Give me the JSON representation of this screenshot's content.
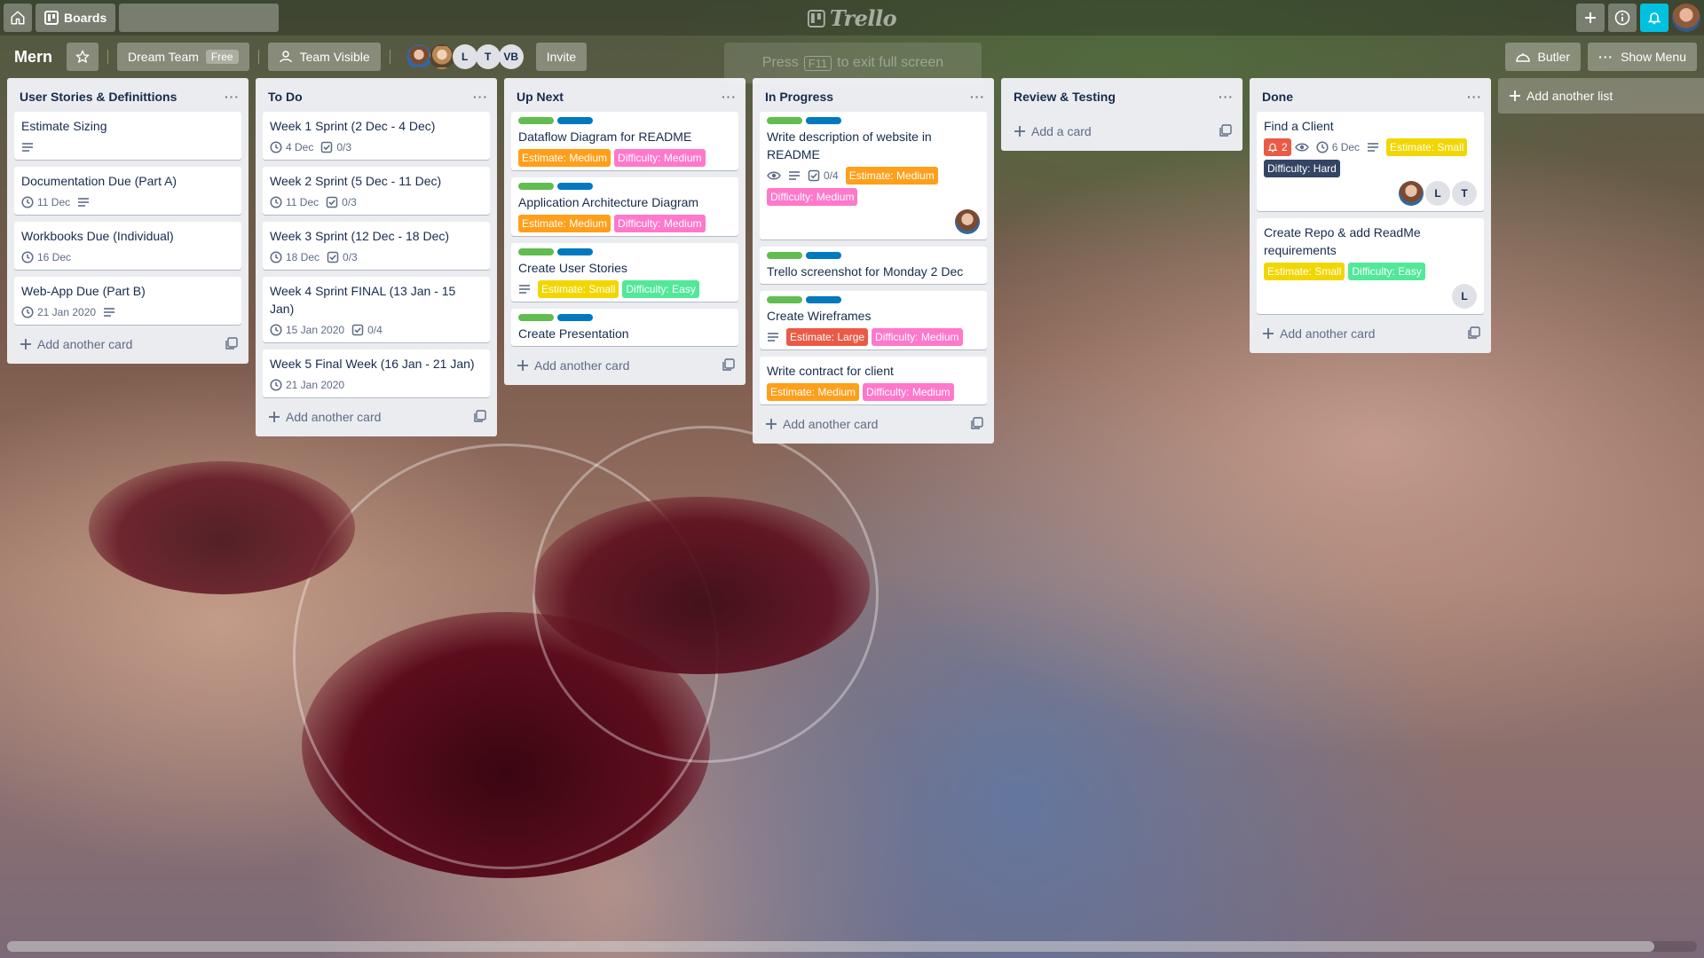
{
  "header": {
    "boards_label": "Boards",
    "search_placeholder": "",
    "logo_text": "Trello"
  },
  "board": {
    "title": "Mern",
    "team_name": "Dream Team",
    "team_badge": "Free",
    "visibility": "Team Visible",
    "members": [
      {
        "initials": "",
        "photo": true
      },
      {
        "initials": "",
        "photo": true
      },
      {
        "initials": "L",
        "photo": false
      },
      {
        "initials": "T",
        "photo": false
      },
      {
        "initials": "VB",
        "photo": false
      }
    ],
    "invite_label": "Invite",
    "butler_label": "Butler",
    "show_menu_label": "Show Menu"
  },
  "fullscreen_hint": {
    "prefix": "Press",
    "key": "F11",
    "suffix": "to exit full screen"
  },
  "colors": {
    "green": "#61bd4f",
    "blue": "#0079bf",
    "orange": "#ff9f1a",
    "pink": "#ff78cb",
    "yellow": "#f2d600",
    "navy": "#344563",
    "red": "#eb5a46",
    "lime": "#51e898",
    "accent_bell": "#00c2e0"
  },
  "lists": [
    {
      "title": "User Stories & Definittions",
      "footer": "Add another card",
      "cards": [
        {
          "title": "Estimate Sizing",
          "description": true
        },
        {
          "title": "Documentation Due (Part A)",
          "due": "11 Dec",
          "description": true
        },
        {
          "title": "Workbooks Due (Individual)",
          "due": "16 Dec"
        },
        {
          "title": "Web-App Due (Part B)",
          "due": "21 Jan 2020",
          "description": true
        }
      ]
    },
    {
      "title": "To Do",
      "footer": "Add another card",
      "cards": [
        {
          "title": "Week 1 Sprint (2 Dec - 4 Dec)",
          "due": "4 Dec",
          "checklist": "0/3"
        },
        {
          "title": "Week 2 Sprint (5 Dec - 11 Dec)",
          "due": "11 Dec",
          "checklist": "0/3"
        },
        {
          "title": "Week 3 Sprint (12 Dec - 18 Dec)",
          "due": "18 Dec",
          "checklist": "0/3"
        },
        {
          "title": "Week 4 Sprint FINAL (13 Jan - 15 Jan)",
          "due": "15 Jan 2020",
          "checklist": "0/4"
        },
        {
          "title": "Week 5 Final Week (16 Jan - 21 Jan)",
          "due": "21 Jan 2020"
        }
      ]
    },
    {
      "title": "Up Next",
      "footer": "Add another card",
      "cards": [
        {
          "title": "Dataflow Diagram for README",
          "bars": [
            "green",
            "blue"
          ],
          "tags": [
            {
              "text": "Estimate: Medium",
              "color": "orange"
            },
            {
              "text": "Difficulty: Medium",
              "color": "pink"
            }
          ]
        },
        {
          "title": "Application Architecture Diagram",
          "bars": [
            "green",
            "blue"
          ],
          "tags": [
            {
              "text": "Estimate: Medium",
              "color": "orange"
            },
            {
              "text": "Difficulty: Medium",
              "color": "pink"
            }
          ]
        },
        {
          "title": "Create User Stories",
          "bars": [
            "green",
            "blue"
          ],
          "description": true,
          "tags": [
            {
              "text": "Estimate: Small",
              "color": "yellow"
            },
            {
              "text": "Difficulty: Easy",
              "color": "lime"
            }
          ]
        },
        {
          "title": "Create Presentation",
          "bars": [
            "green",
            "blue"
          ]
        }
      ]
    },
    {
      "title": "In Progress",
      "footer": "Add another card",
      "cards": [
        {
          "title": "Write description of website in README",
          "bars": [
            "green",
            "blue"
          ],
          "watching": true,
          "description": true,
          "checklist": "0/4",
          "tags": [
            {
              "text": "Estimate: Medium",
              "color": "orange"
            },
            {
              "text": "Difficulty: Medium",
              "color": "pink"
            }
          ],
          "members": [
            {
              "initials": "",
              "photo": true
            }
          ]
        },
        {
          "title": "Trello screenshot for Monday 2 Dec",
          "bars": [
            "green",
            "blue"
          ]
        },
        {
          "title": "Create Wireframes",
          "bars": [
            "green",
            "blue"
          ],
          "description": true,
          "tags": [
            {
              "text": "Estimate: Large",
              "color": "red"
            },
            {
              "text": "Difficulty: Medium",
              "color": "pink"
            }
          ]
        },
        {
          "title": "Write contract for client",
          "tags": [
            {
              "text": "Estimate: Medium",
              "color": "orange"
            },
            {
              "text": "Difficulty: Medium",
              "color": "pink"
            }
          ]
        }
      ]
    },
    {
      "title": "Review & Testing",
      "footer": "Add a card",
      "cards": []
    },
    {
      "title": "Done",
      "footer": "Add another card",
      "cards": [
        {
          "title": "Find a Client",
          "alert": "2",
          "watching": true,
          "due": "6 Dec",
          "description": true,
          "tags": [
            {
              "text": "Estimate: Small",
              "color": "yellow"
            },
            {
              "text": "Difficulty: Hard",
              "color": "navy"
            }
          ],
          "members": [
            {
              "initials": "",
              "photo": true
            },
            {
              "initials": "L",
              "photo": false
            },
            {
              "initials": "T",
              "photo": false
            }
          ]
        },
        {
          "title": "Create Repo & add ReadMe requirements",
          "tags": [
            {
              "text": "Estimate: Small",
              "color": "yellow"
            },
            {
              "text": "Difficulty: Easy",
              "color": "lime"
            }
          ],
          "members": [
            {
              "initials": "L",
              "photo": false
            }
          ]
        }
      ]
    }
  ],
  "add_list_label": "Add another list"
}
